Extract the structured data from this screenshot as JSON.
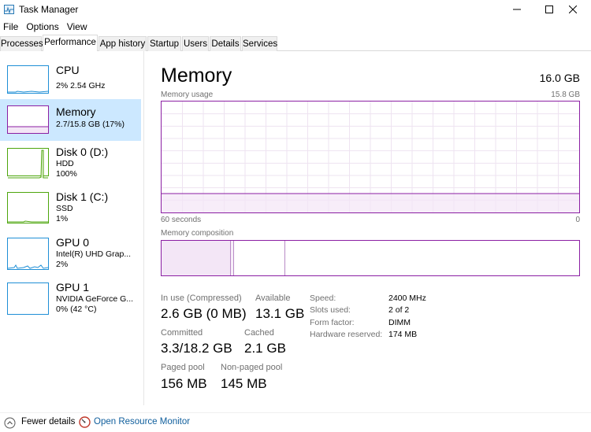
{
  "window": {
    "title": "Task Manager"
  },
  "menu": [
    "File",
    "Options",
    "View"
  ],
  "tabs": [
    "Processes",
    "Performance",
    "App history",
    "Startup",
    "Users",
    "Details",
    "Services"
  ],
  "active_tab": "Performance",
  "sidebar": {
    "items": [
      {
        "title": "CPU",
        "line1": "2%  2.54 GHz",
        "line2": "",
        "color": "#1f8fd6"
      },
      {
        "title": "Memory",
        "line1": "2.7/15.8 GB (17%)",
        "line2": "",
        "color": "#8b1fa3",
        "selected": true
      },
      {
        "title": "Disk 0 (D:)",
        "line1": "HDD",
        "line2": "100%",
        "color": "#4da60c"
      },
      {
        "title": "Disk 1 (C:)",
        "line1": "SSD",
        "line2": "1%",
        "color": "#4da60c"
      },
      {
        "title": "GPU 0",
        "line1": "Intel(R) UHD Grap...",
        "line2": "2%",
        "color": "#1f8fd6"
      },
      {
        "title": "GPU 1",
        "line1": "NVIDIA GeForce G...",
        "line2": "0%  (42 °C)",
        "color": "#1f8fd6"
      }
    ]
  },
  "main": {
    "title": "Memory",
    "total": "16.0 GB",
    "usage_label": "Memory usage",
    "usage_max": "15.8 GB",
    "time_left": "60 seconds",
    "time_right": "0",
    "usage_fraction": 0.17,
    "composition_label": "Memory composition",
    "stats": {
      "in_use_label": "In use (Compressed)",
      "in_use_value": "2.6 GB (0 MB)",
      "available_label": "Available",
      "available_value": "13.1 GB",
      "committed_label": "Committed",
      "committed_value": "3.3/18.2 GB",
      "cached_label": "Cached",
      "cached_value": "2.1 GB",
      "paged_label": "Paged pool",
      "paged_value": "156 MB",
      "nonpaged_label": "Non-paged pool",
      "nonpaged_value": "145 MB"
    },
    "specs": {
      "speed_label": "Speed:",
      "speed_value": "2400 MHz",
      "slots_label": "Slots used:",
      "slots_value": "2 of 2",
      "form_label": "Form factor:",
      "form_value": "DIMM",
      "reserved_label": "Hardware reserved:",
      "reserved_value": "174 MB"
    }
  },
  "footer": {
    "fewer_details": "Fewer details",
    "open_monitor": "Open Resource Monitor"
  },
  "colors": {
    "memory": "#8b1fa3",
    "selected_bg": "#cce8ff",
    "link": "#0f5e9c"
  }
}
